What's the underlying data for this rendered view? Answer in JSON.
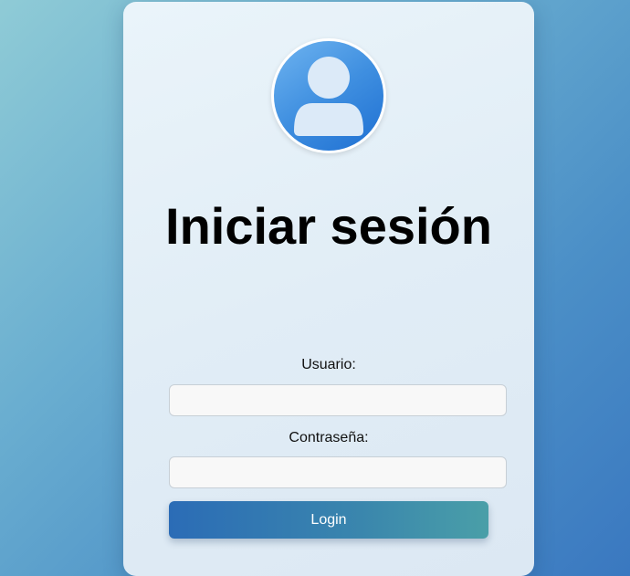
{
  "login": {
    "title": "Iniciar sesión",
    "username_label": "Usuario:",
    "username_value": "",
    "password_label": "Contraseña:",
    "password_value": "",
    "submit_label": "Login"
  },
  "icons": {
    "avatar": "user-avatar-icon"
  },
  "colors": {
    "avatar_gradient_start": "#6fb4f0",
    "avatar_gradient_end": "#1e6fd2",
    "button_gradient_start": "#2b6cb6",
    "button_gradient_end": "#4a9fa8",
    "title_color": "#000000"
  }
}
